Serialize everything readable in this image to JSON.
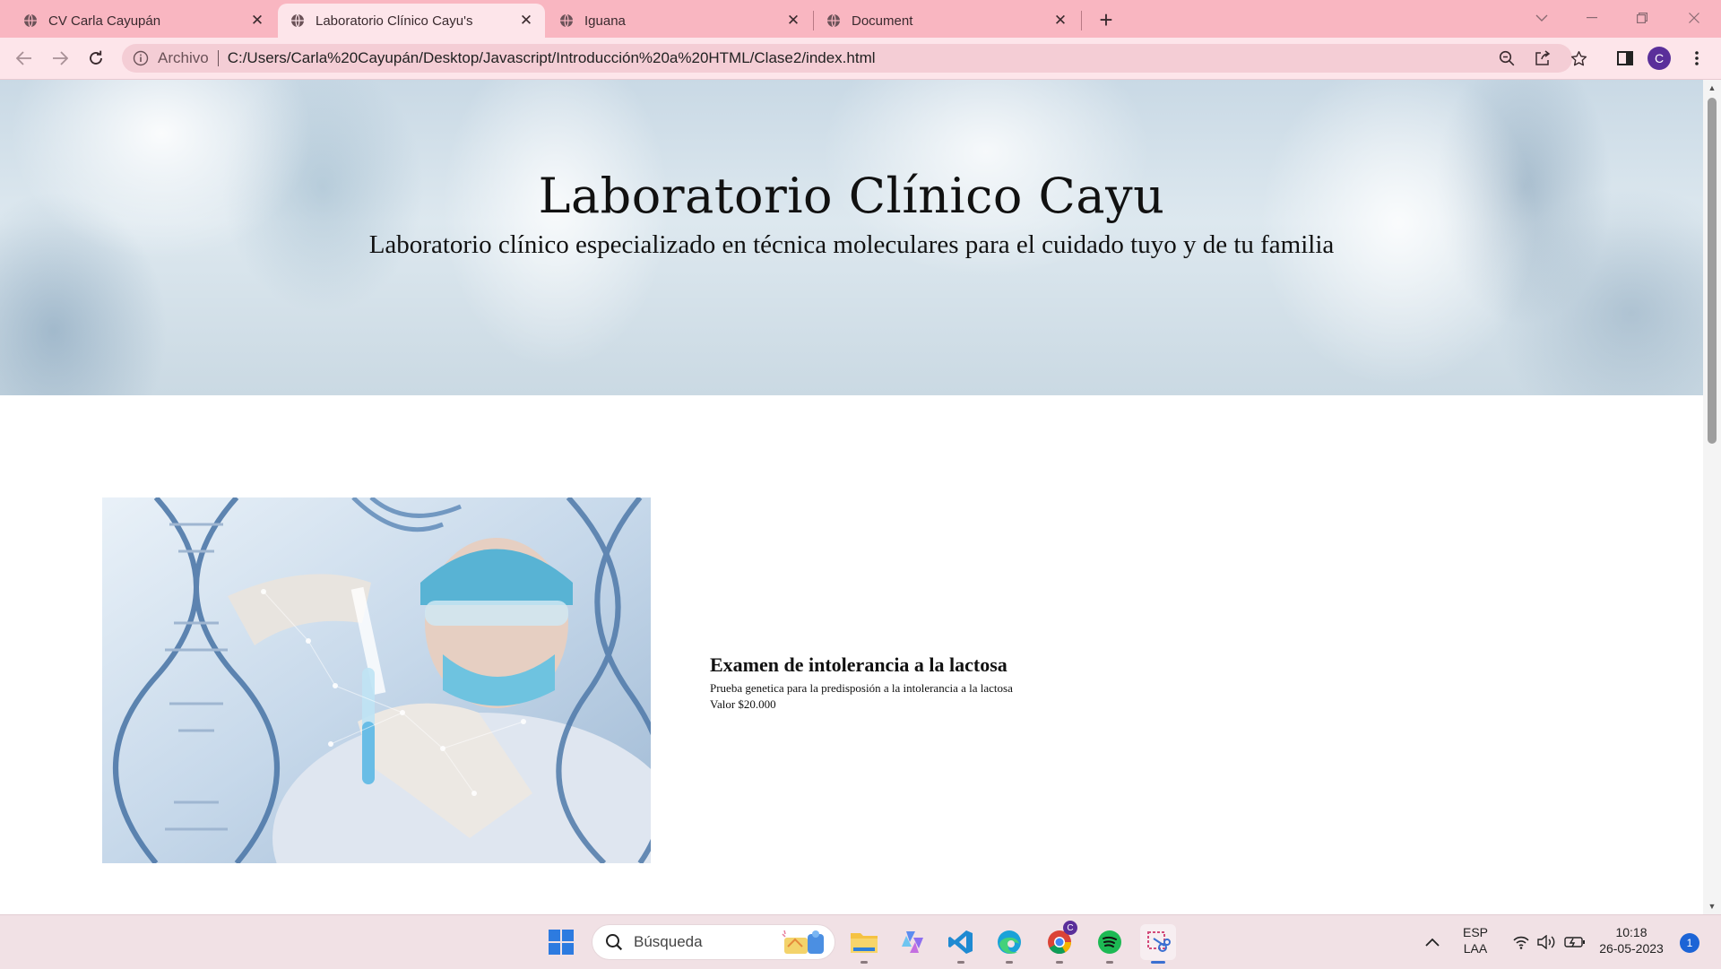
{
  "browser": {
    "tabs": [
      {
        "title": "CV Carla Cayupán",
        "active": false
      },
      {
        "title": "Laboratorio Clínico Cayu's",
        "active": true
      },
      {
        "title": "Iguana",
        "active": false
      },
      {
        "title": "Document",
        "active": false
      }
    ],
    "address": {
      "security_label": "Archivo",
      "url": "C:/Users/Carla%20Cayupán/Desktop/Javascript/Introducción%20a%20HTML/Clase2/index.html"
    },
    "profile_initial": "C"
  },
  "page": {
    "hero": {
      "title": "Laboratorio Clínico Cayu",
      "subtitle": "Laboratorio clínico especializado en técnica moleculares para el cuidado tuyo y de tu familia"
    },
    "product": {
      "name": "Examen de intolerancia a la lactosa",
      "description": "Prueba genetica para la predisposión a la intolerancia a la lactosa",
      "price": "Valor $20.000"
    }
  },
  "taskbar": {
    "search_placeholder": "Búsqueda",
    "chrome_badge": "C",
    "language": "ESP",
    "keyboard": "LAA",
    "time": "10:18",
    "date": "26-05-2023",
    "notifications": "1"
  },
  "colors": {
    "tabstrip": "#f9b6c1",
    "toolbar": "#fde5ea",
    "accent": "#5a2f9a"
  }
}
